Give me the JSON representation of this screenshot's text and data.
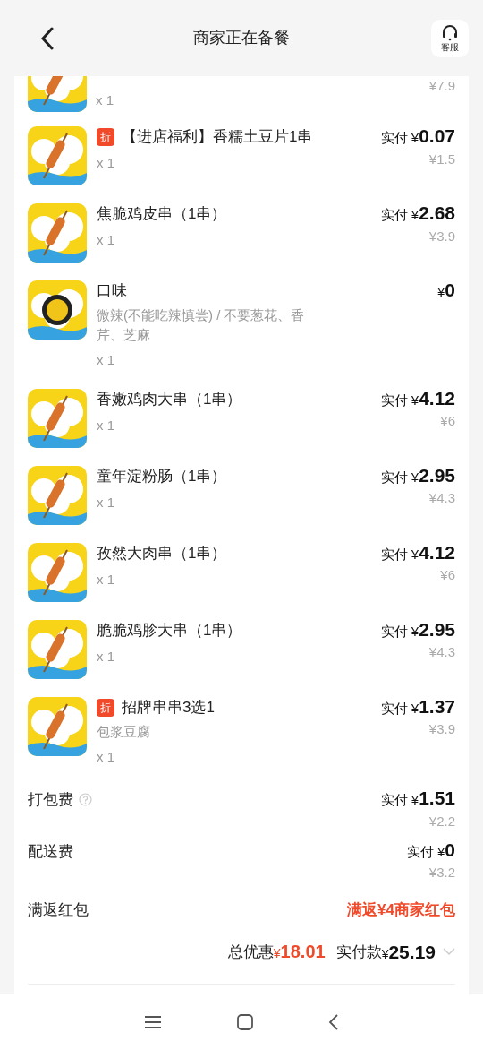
{
  "header": {
    "title": "商家正在备餐",
    "service_label": "客服"
  },
  "items": [
    {
      "kind": "cut",
      "qty": "x 1",
      "original": "¥7.9"
    },
    {
      "kind": "product",
      "badge": "折",
      "title": "【进店福利】香糯土豆片1串",
      "qty": "x 1",
      "paid_label": "实付 ¥",
      "paid": "0.07",
      "original": "¥1.5"
    },
    {
      "kind": "product",
      "title": "焦脆鸡皮串（1串）",
      "qty": "x 1",
      "paid_label": "实付 ¥",
      "paid": "2.68",
      "original": "¥3.9"
    },
    {
      "kind": "option",
      "title": "口味",
      "note": "微辣(不能吃辣慎尝) / 不要葱花、香芹、芝麻",
      "qty": "x 1",
      "paid_label": "¥",
      "paid": "0"
    },
    {
      "kind": "product",
      "title": "香嫩鸡肉大串（1串）",
      "qty": "x 1",
      "paid_label": "实付 ¥",
      "paid": "4.12",
      "original": "¥6"
    },
    {
      "kind": "product",
      "title": "童年淀粉肠（1串）",
      "qty": "x 1",
      "paid_label": "实付 ¥",
      "paid": "2.95",
      "original": "¥4.3"
    },
    {
      "kind": "product",
      "title": "孜然大肉串（1串）",
      "qty": "x 1",
      "paid_label": "实付 ¥",
      "paid": "4.12",
      "original": "¥6"
    },
    {
      "kind": "product",
      "title": "脆脆鸡胗大串（1串）",
      "qty": "x 1",
      "paid_label": "实付 ¥",
      "paid": "2.95",
      "original": "¥4.3"
    },
    {
      "kind": "product",
      "badge": "折",
      "title": "招牌串串3选1",
      "note": "包浆豆腐",
      "qty": "x 1",
      "paid_label": "实付 ¥",
      "paid": "1.37",
      "original": "¥3.9"
    }
  ],
  "fees": [
    {
      "label": "打包费",
      "help": true,
      "paid_label": "实付 ¥",
      "paid": "1.51",
      "original": "¥2.2"
    },
    {
      "label": "配送费",
      "help": false,
      "paid_label": "实付 ¥",
      "paid": "0",
      "original": "¥3.2"
    }
  ],
  "red_packet": {
    "label": "满返红包",
    "value": "满返¥4商家红包"
  },
  "summary": {
    "discount_label": "总优惠",
    "discount_currency": "¥",
    "discount": "18.01",
    "total_label": "实付款",
    "total_currency": "¥",
    "total": "25.19"
  }
}
